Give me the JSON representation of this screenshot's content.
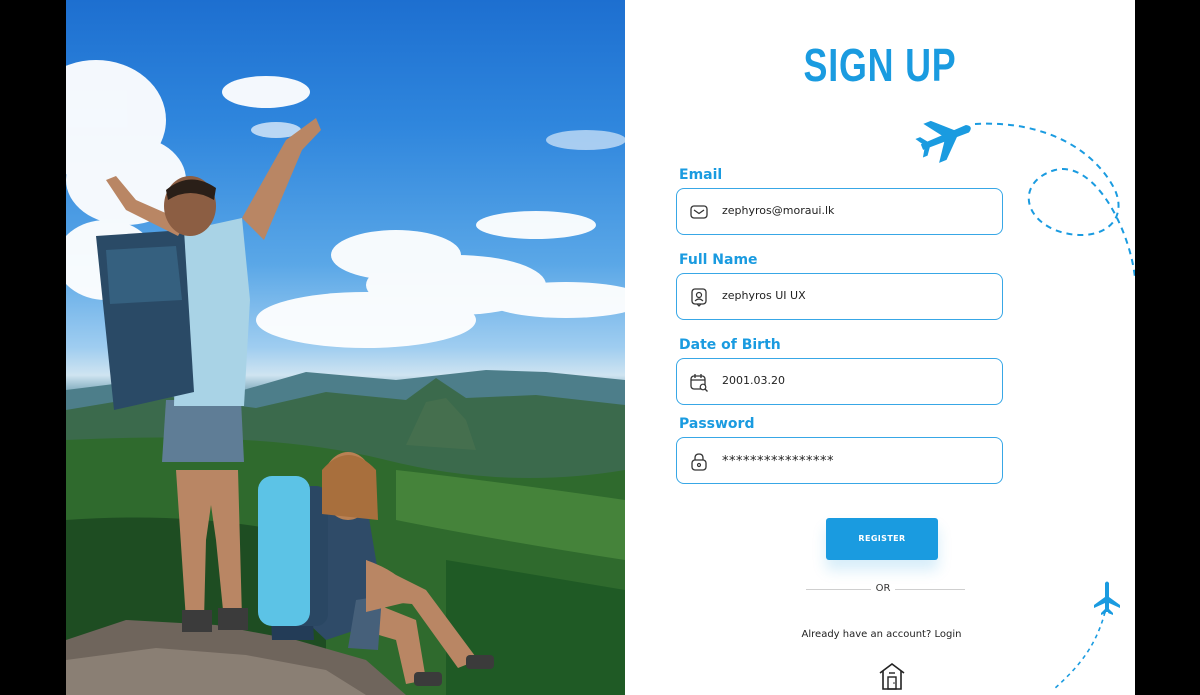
{
  "form": {
    "title": "SIGN UP",
    "email": {
      "label": "Email",
      "value": "zephyros@moraui.lk",
      "icon": "mail-icon"
    },
    "full_name": {
      "label": "Full Name",
      "value": "zephyros UI UX",
      "icon": "user-badge-icon"
    },
    "dob": {
      "label": "Date of Birth",
      "value": "2001.03.20",
      "icon": "calendar-search-icon"
    },
    "password": {
      "label": "Password",
      "value": "****************",
      "icon": "lock-icon"
    },
    "register_label": "REGISTER",
    "or_text": "OR",
    "login_prompt": "Already have an account? Login",
    "home_icon": "home-icon"
  },
  "colors": {
    "accent": "#1a9be0",
    "border": "#38a7e6",
    "background": "#ffffff",
    "frame": "#000000"
  }
}
